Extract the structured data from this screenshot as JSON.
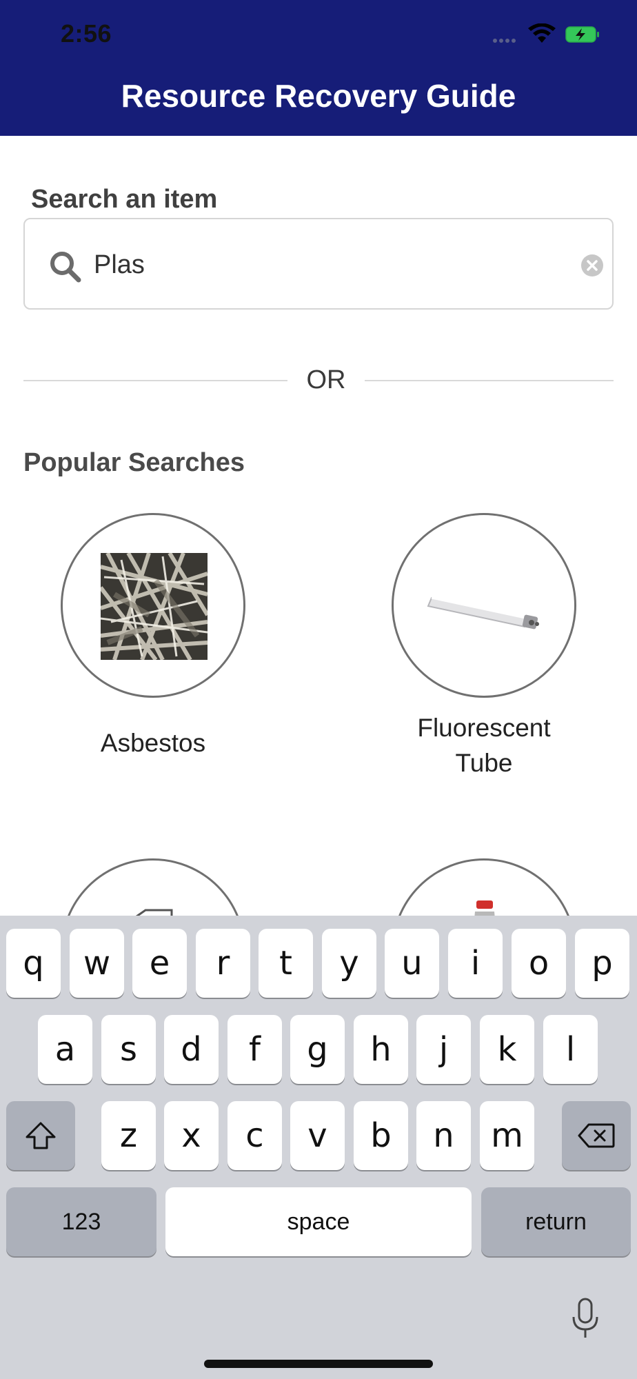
{
  "status_bar": {
    "time": "2:56"
  },
  "header": {
    "title": "Resource Recovery Guide"
  },
  "search": {
    "label": "Search an item",
    "value": "Plas"
  },
  "divider": {
    "text": "OR"
  },
  "popular": {
    "title": "Popular Searches",
    "items": [
      {
        "label": "Asbestos",
        "icon": "asbestos-photo"
      },
      {
        "label": "Fluorescent\nTube",
        "icon": "fluorescent-tube-photo"
      }
    ]
  },
  "keyboard": {
    "row1": [
      "q",
      "w",
      "e",
      "r",
      "t",
      "y",
      "u",
      "i",
      "o",
      "p"
    ],
    "row2": [
      "a",
      "s",
      "d",
      "f",
      "g",
      "h",
      "j",
      "k",
      "l"
    ],
    "row3": [
      "z",
      "x",
      "c",
      "v",
      "b",
      "n",
      "m"
    ],
    "numbers_label": "123",
    "space_label": "space",
    "return_label": "return"
  },
  "colors": {
    "header_bg": "#161d78",
    "keyboard_bg": "#d1d3d9",
    "battery": "#34c759"
  }
}
